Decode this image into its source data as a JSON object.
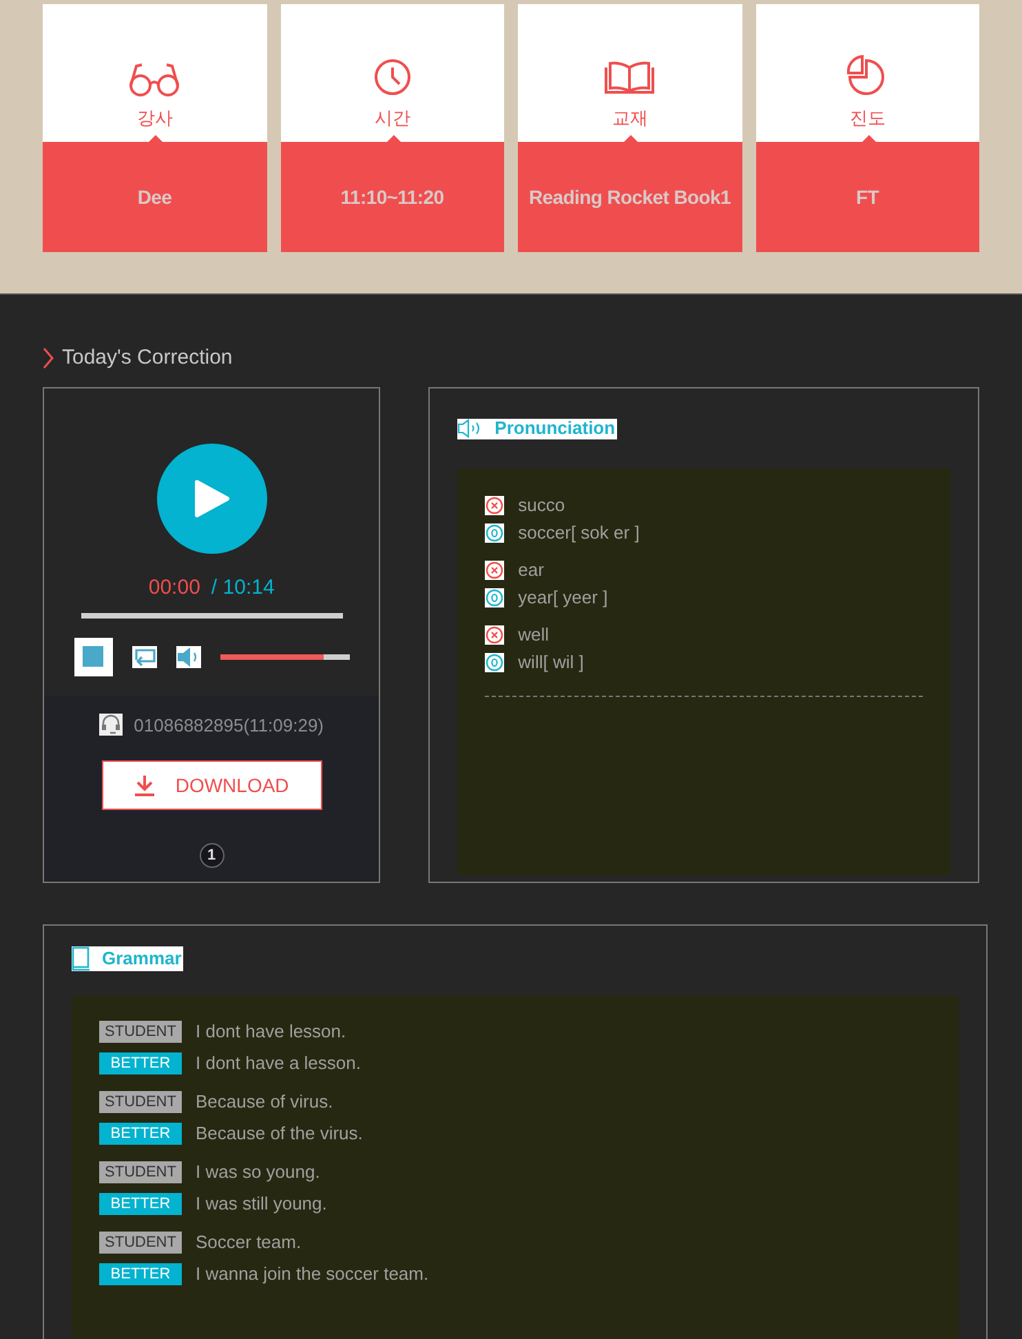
{
  "info_cards": [
    {
      "label": "강사",
      "value": "Dee"
    },
    {
      "label": "시간",
      "value": "11:10~11:20"
    },
    {
      "label": "교재",
      "value": "Reading Rocket Book1"
    },
    {
      "label": "진도",
      "value": "FT"
    }
  ],
  "section_title": "Today's Correction",
  "player": {
    "current": "00:00",
    "total": "/ 10:14",
    "progress": {
      "level": 0
    },
    "volume": {
      "level": 0.8
    },
    "caller": "01086882895(11:09:29)",
    "download": "DOWNLOAD",
    "pages": [
      {
        "label": "1",
        "selected": true
      }
    ]
  },
  "pronunciation": {
    "title": "Pronunciation",
    "groups": [
      {
        "items": [
          {
            "kind": "wrong",
            "text": "succo"
          },
          {
            "kind": "right",
            "text": "soccer[ sok er ]"
          }
        ]
      },
      {
        "items": [
          {
            "kind": "wrong",
            "text": "ear"
          },
          {
            "kind": "right",
            "text": "year[ yeer ]"
          }
        ]
      },
      {
        "items": [
          {
            "kind": "wrong",
            "text": "well"
          },
          {
            "kind": "right",
            "text": "will[ wil ]"
          }
        ]
      }
    ]
  },
  "grammar": {
    "title": "Grammar",
    "pairs": [
      {
        "student_tag": "STUDENT",
        "student": "I dont have lesson.",
        "better_tag": "BETTER",
        "better": "I dont have a lesson."
      },
      {
        "student_tag": "STUDENT",
        "student": "Because of virus.",
        "better_tag": "BETTER",
        "better": "Because of the virus."
      },
      {
        "student_tag": "STUDENT",
        "student": "I was so young.",
        "better_tag": "BETTER",
        "better": "I was still young."
      },
      {
        "student_tag": "STUDENT",
        "student": "Soccer team.",
        "better_tag": "BETTER",
        "better": "I wanna join the soccer team."
      }
    ]
  }
}
